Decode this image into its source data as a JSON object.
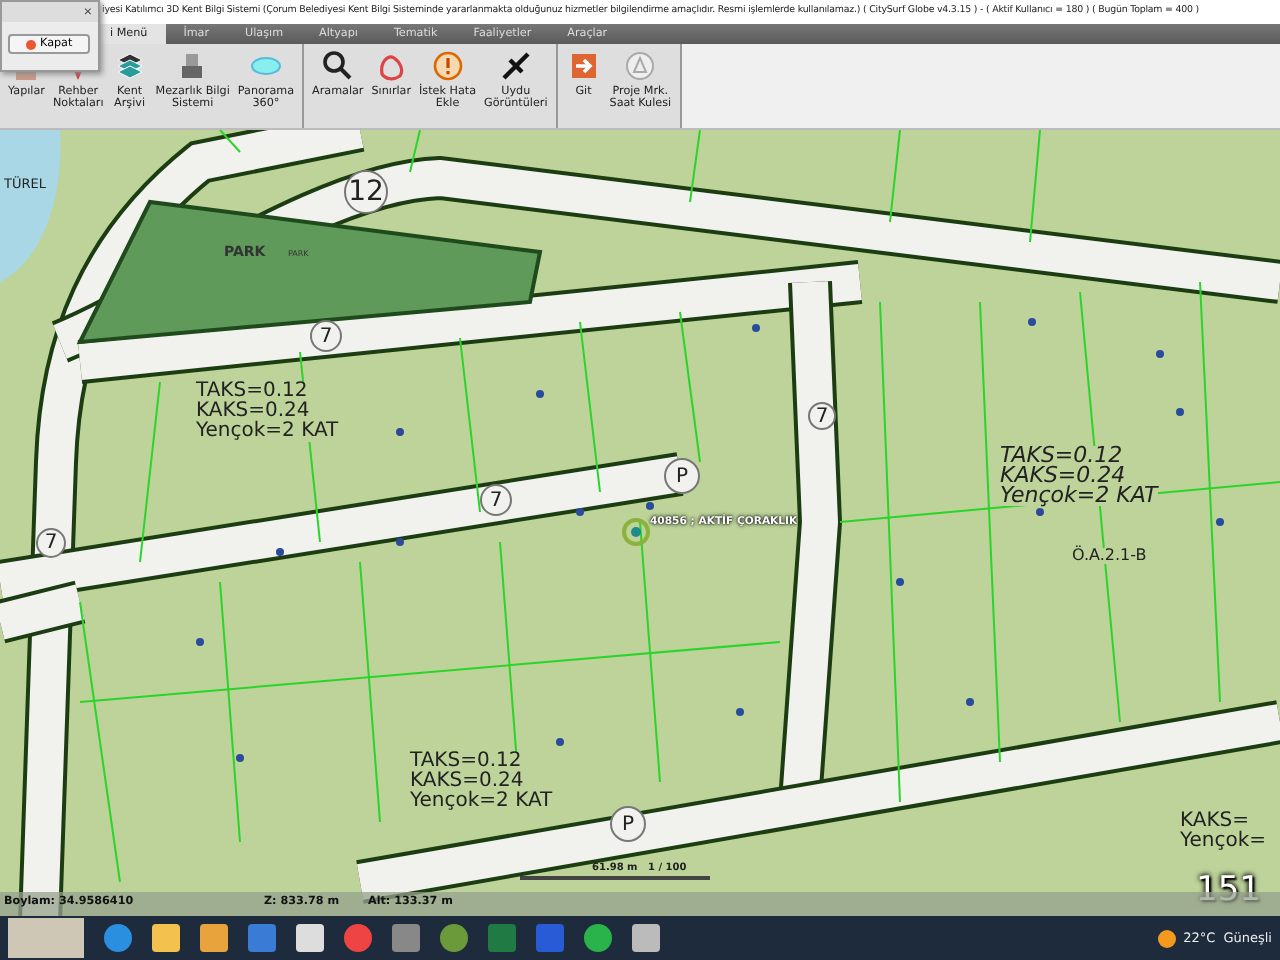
{
  "window": {
    "title": "iyesi Katılımcı 3D Kent Bilgi Sistemi (Çorum Belediyesi Kent Bilgi Sisteminde yararlanmakta olduğunuz hizmetler bilgilendirme amaçlıdır. Resmi işlemlerde kullanılamaz.)   ( CitySurf Globe v4.3.15 ) -   ( Aktif Kullanıcı = 180 )   ( Bugün Toplam = 400 )"
  },
  "popup": {
    "close": "×",
    "button": "Kapat"
  },
  "tabs": [
    {
      "label": "i Menü",
      "selected": true
    },
    {
      "label": "İmar",
      "selected": false
    },
    {
      "label": "Ulaşım",
      "selected": false
    },
    {
      "label": "Altyapı",
      "selected": false
    },
    {
      "label": "Tematik",
      "selected": false
    },
    {
      "label": "Faaliyetler",
      "selected": false
    },
    {
      "label": "Araçlar",
      "selected": false
    }
  ],
  "toolbar_groups": [
    {
      "buttons": [
        "Yapılar",
        "Rehber Noktaları",
        "Kent Arşivi",
        "Mezarlık Bilgi Sistemi",
        "Panorama 360°"
      ]
    },
    {
      "buttons": [
        "Aramalar",
        "Sınırlar",
        "İstek Hata Ekle",
        "Uydu Görüntüleri"
      ]
    },
    {
      "buttons": [
        "Git",
        "Proje Mrk. Saat Kulesi"
      ]
    }
  ],
  "map": {
    "district_label": "TÜREL",
    "road_widths": [
      "12",
      "7",
      "7",
      "7",
      "7"
    ],
    "parking_signs": [
      "P",
      "P"
    ],
    "park": {
      "label": "PARK",
      "sublabel": "PARK"
    },
    "zoning_blocks": [
      {
        "lines": [
          "TAKS=0.12",
          "KAKS=0.24",
          "Yençok=2 KAT"
        ]
      },
      {
        "lines": [
          "TAKS=0.12",
          "KAKS=0.24",
          "Yençok=2 KAT"
        ]
      },
      {
        "lines": [
          "TAKS=0.12",
          "KAKS=0.24",
          "Yençok=2 KAT"
        ]
      },
      {
        "lines": [
          "KAKS=",
          "Yençok="
        ]
      }
    ],
    "zone_code": "Ö.A.2.1-B",
    "parcel_label": "40856 ;  AKTİF ÇORAKLIK",
    "scale": {
      "distance": "61.98 m",
      "ratio": "1 / 100"
    },
    "frame_counter": "151"
  },
  "status_bar": {
    "longitude": "Boylam: 34.9586410",
    "elevation": "Z: 833.78 m",
    "altitude": "Alt: 133.37 m"
  },
  "taskbar": {
    "temperature": "22°C",
    "weather": "Güneşli"
  }
}
